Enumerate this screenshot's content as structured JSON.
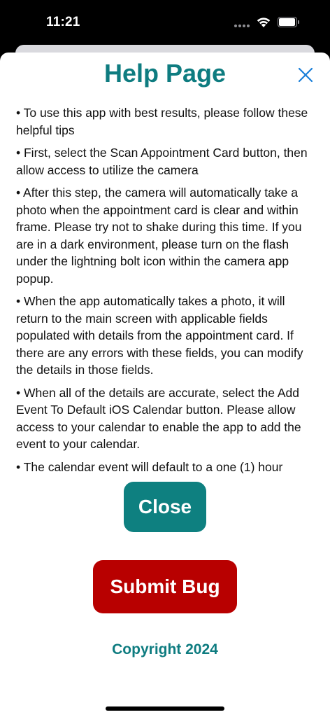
{
  "status_bar": {
    "time": "11:21",
    "icons": [
      "signal-dots-icon",
      "wifi-icon",
      "battery-icon"
    ]
  },
  "header": {
    "title": "Help Page",
    "close_icon": "close-x-icon",
    "accent_color": "#0e7c80"
  },
  "content": {
    "paragraphs": [
      "• To use this app with best results, please follow these helpful tips",
      "• First, select the Scan Appointment Card button, then allow access to utilize the camera",
      "• After this step, the camera will automatically take a photo when the appointment card is clear and within frame. Please try not to shake during this time. If you are in a dark environment, please turn on the flash under the lightning bolt icon within the camera app popup.",
      "• When the app automatically takes a photo, it will return to the main screen with applicable fields populated with details from the appointment card. If there are any errors with these fields, you can modify the details in those fields.",
      "• When all of the details are accurate, select the Add Event To Default iOS Calendar button. Please allow access to your calendar to enable the app to add the event to your calendar.",
      "• The calendar event will default to a one (1) hour"
    ]
  },
  "buttons": {
    "close_label": "Close",
    "close_color": "#0e8080",
    "bug_label": "Submit Bug",
    "bug_color": "#b80000"
  },
  "footer": {
    "copyright": "Copyright 2024"
  }
}
